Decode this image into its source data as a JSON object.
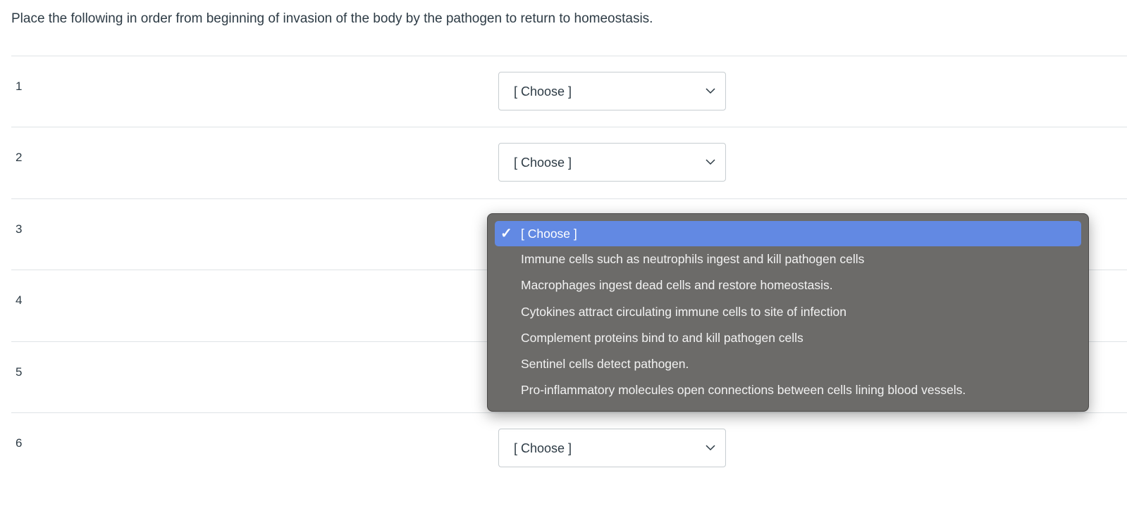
{
  "question": "Place the following in order from beginning of invasion of the body by the pathogen to return to homeostasis.",
  "rows": [
    {
      "number": "1",
      "value": "[ Choose ]"
    },
    {
      "number": "2",
      "value": "[ Choose ]"
    },
    {
      "number": "3",
      "value": "[ Choose ]"
    },
    {
      "number": "4",
      "value": "[ Choose ]"
    },
    {
      "number": "5",
      "value": "[ Choose ]"
    },
    {
      "number": "6",
      "value": "[ Choose ]"
    }
  ],
  "dropdown": {
    "open_for_row": "3",
    "selected": "[ Choose ]",
    "highlight_color": "#6289e3",
    "options": [
      "[ Choose ]",
      "Immune cells such as neutrophils ingest and kill pathogen cells",
      "Macrophages ingest dead cells and restore homeostasis.",
      "Cytokines attract circulating immune cells to site of infection",
      "Complement proteins bind to and kill pathogen cells",
      "Sentinel cells detect pathogen.",
      "Pro-inflammatory molecules open connections between cells lining blood vessels."
    ]
  }
}
